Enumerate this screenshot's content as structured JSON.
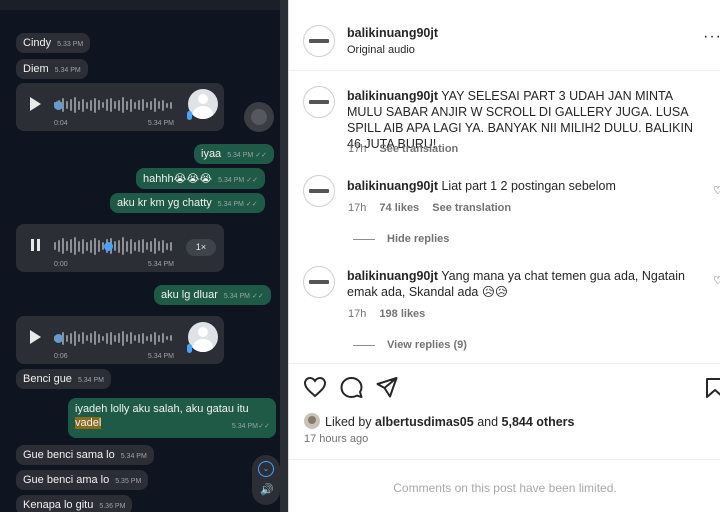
{
  "chat": {
    "messages": [
      {
        "text": "Cindy",
        "time": "5.33 PM"
      },
      {
        "text": "Diem",
        "time": "5.34 PM"
      },
      {
        "voice_elapsed": "0:04",
        "time": "5.34 PM"
      },
      {
        "text": "iyaa",
        "time": "5.34 PM"
      },
      {
        "text": "hahhh😭😭😭",
        "time": "5.34 PM"
      },
      {
        "text": "aku kr km yg chatty",
        "time": "5.34 PM"
      },
      {
        "voice_elapsed": "0:00",
        "time": "5.34 PM",
        "speed": "1×"
      },
      {
        "text": "aku lg dluar",
        "time": "5.34 PM"
      },
      {
        "voice_elapsed": "0:06",
        "time": "5.34 PM"
      },
      {
        "text": "Benci gue",
        "time": "5.34 PM"
      },
      {
        "text_line1": "iyadeh lolly aku salah, aku gatau itu",
        "text_line2": "vadel",
        "time": "5.34 PM"
      },
      {
        "text": "Gue benci sama lo",
        "time": "5.34 PM"
      },
      {
        "text": "Gue benci ama lo",
        "time": "5.35 PM"
      },
      {
        "text": "Kenapa lo gitu",
        "time": "5.36 PM"
      }
    ]
  },
  "post": {
    "username": "balikinuang90jt",
    "audio": "Original audio",
    "caption": {
      "username": "balikinuang90jt",
      "text": "YAY SELESAI PART 3 UDAH JAN MINTA MULU SABAR ANJIR W SCROLL DI GALLERY JUGA. LUSA SPILL AIB APA LAGI YA. BANYAK NII MILIH2 DULU. BALIKIN 46 JUTA BURU!",
      "age": "17h",
      "translate": "See translation"
    },
    "comments": [
      {
        "username": "balikinuang90jt",
        "text": "Liat part 1 2 postingan sebelom",
        "age": "17h",
        "likes": "74 likes",
        "translate": "See translation",
        "replies_toggle": "Hide replies"
      },
      {
        "username": "balikinuang90jt",
        "text": "Yang mana ya chat temen gua ada, Ngatain emak ada, Skandal ada 😥😥",
        "age": "17h",
        "likes": "198 likes",
        "replies_toggle": "View replies (9)"
      }
    ],
    "liked_by_prefix": "Liked by",
    "liked_by_user": "albertusdimas05",
    "liked_by_and": "and",
    "liked_by_others": "5,844 others",
    "posted_ago": "17 hours ago",
    "comments_limited": "Comments on this post have been limited.",
    "colors": {
      "incoming_bubble": "#2b2f35",
      "outgoing_bubble": "#1e5a45",
      "voice_accent": "#4aa3ff"
    }
  }
}
